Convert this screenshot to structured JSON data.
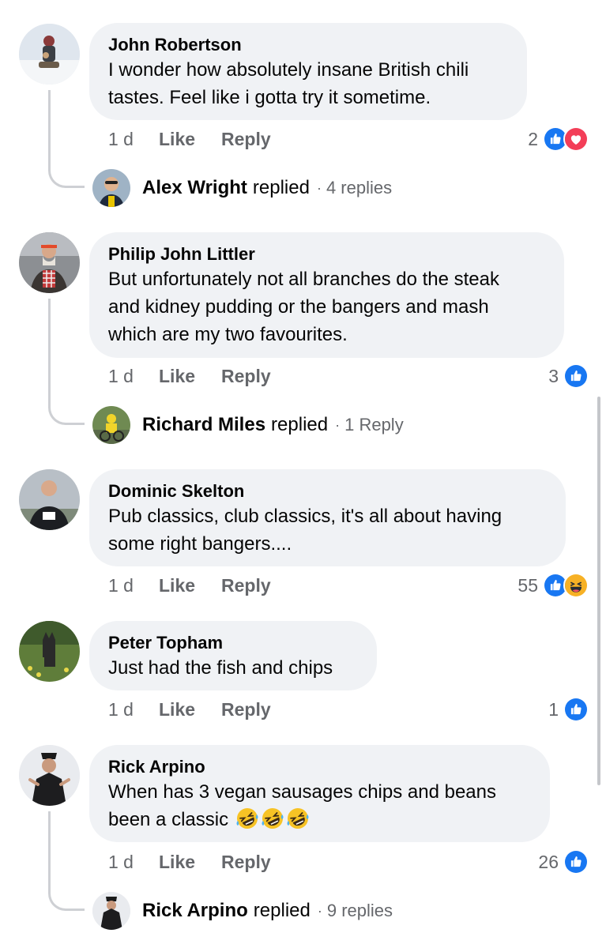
{
  "actions": {
    "like": "Like",
    "reply": "Reply"
  },
  "colors": {
    "like_blue": "#1877f2",
    "love_red": "#f33e58",
    "haha_yellow": "#f7b125",
    "bubble": "#f0f2f5",
    "meta_gray": "#65676b"
  },
  "comments": [
    {
      "author": "John Robertson",
      "lines": [
        "I wonder how absolutely insane British chili",
        "tastes. Feel like i gotta try it sometime."
      ],
      "time": "1 d",
      "reaction_count": "2",
      "reactions": [
        "like-icon",
        "love-icon"
      ],
      "reply_preview": {
        "name": "Alex Wright",
        "word": "replied",
        "count": "4 replies"
      }
    },
    {
      "author": "Philip John Littler",
      "lines": [
        "But unfortunately not all branches do the steak",
        "and kidney pudding or the bangers and mash",
        "which are my two favourites."
      ],
      "time": "1 d",
      "reaction_count": "3",
      "reactions": [
        "like-icon"
      ],
      "reply_preview": {
        "name": "Richard Miles",
        "word": "replied",
        "count": "1 Reply"
      }
    },
    {
      "author": "Dominic Skelton",
      "lines": [
        "Pub classics, club classics, it's all about having",
        "some right bangers...."
      ],
      "time": "1 d",
      "reaction_count": "55",
      "reactions": [
        "like-icon",
        "haha-icon"
      ]
    },
    {
      "author": "Peter Topham",
      "lines": [
        "Just had the fish and chips"
      ],
      "time": "1 d",
      "reaction_count": "1",
      "reactions": [
        "like-icon"
      ]
    },
    {
      "author": "Rick Arpino",
      "lines": [
        "When has 3 vegan sausages chips and beans",
        "been a classic"
      ],
      "emoji": [
        "rolling-on-floor-laughing-emoji",
        "rolling-on-floor-laughing-emoji",
        "rolling-on-floor-laughing-emoji"
      ],
      "time": "1 d",
      "reaction_count": "26",
      "reactions": [
        "like-icon"
      ],
      "reply_preview": {
        "name": "Rick Arpino",
        "word": "replied",
        "count": "9 replies"
      }
    }
  ]
}
